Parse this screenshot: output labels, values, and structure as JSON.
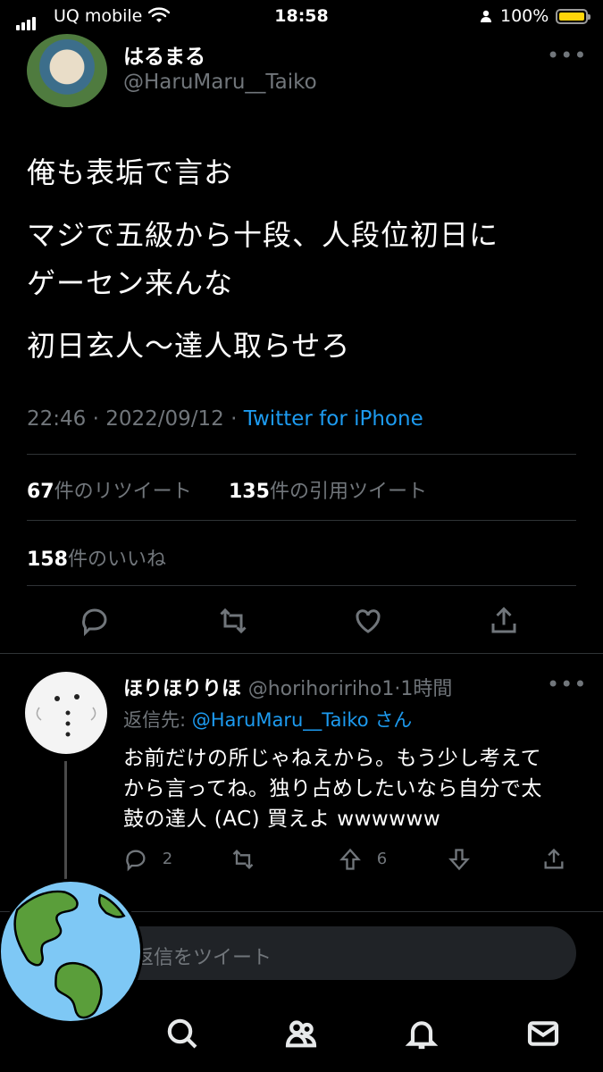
{
  "status_bar": {
    "carrier": "UQ mobile",
    "time": "18:58",
    "battery_text": "100%",
    "battery_level": 1.0,
    "battery_color": "#ffd60a"
  },
  "tweet": {
    "display_name": "はるまる",
    "handle": "@HaruMaru__Taiko",
    "lines": [
      "俺も表垢で言お",
      "マジで五級から十段、人段位初日に",
      "ゲーセン来んな",
      "初日玄人〜達人取らせろ"
    ],
    "time": "22:46",
    "date": "2022/09/12",
    "source": "Twitter for iPhone",
    "retweets_count": "67",
    "retweets_label": "件のリツイート",
    "quotes_count": "135",
    "quotes_label": "件の引用ツイート",
    "likes_count": "158",
    "likes_label": "件のいいね"
  },
  "reply": {
    "display_name": "ほりほりりほ",
    "handle": "@horihoririho1",
    "time": "1時間",
    "replying_prefix": "返信先:",
    "replying_to": "@HaruMaru__Taiko",
    "replying_suffix": "さん",
    "text_lines": [
      "お前だけの所じゃねえから。もう少し考えて",
      "から言ってね。独り占めしたいなら自分で太",
      "鼓の達人 (AC) 買えよ wwwwww"
    ],
    "reply_count": "2",
    "upvote_count": "6"
  },
  "compose": {
    "placeholder": "返信をツイート"
  },
  "colors": {
    "accent": "#1d9bf0",
    "secondary_text": "#71767b",
    "background": "#000000"
  }
}
